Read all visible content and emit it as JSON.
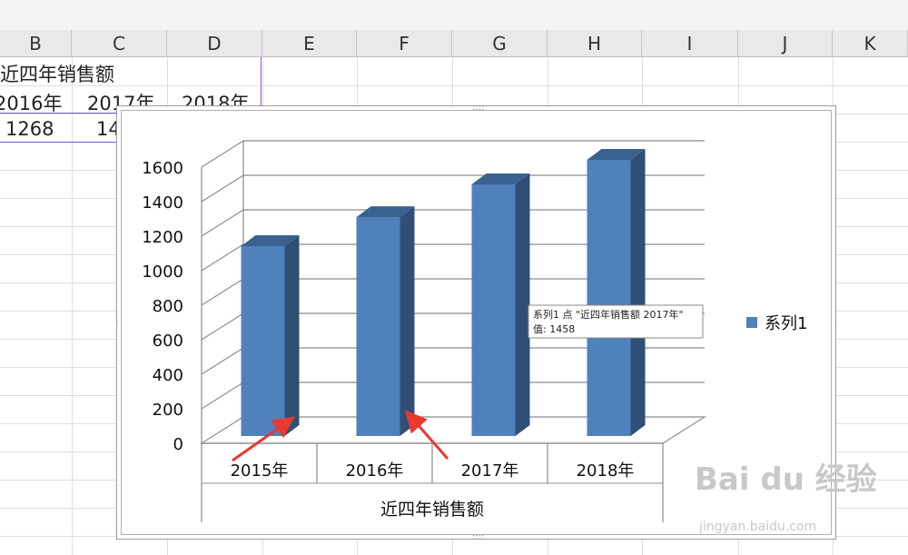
{
  "sheet": {
    "columns": [
      "B",
      "C",
      "D",
      "E",
      "F",
      "G",
      "H",
      "I",
      "J",
      "K"
    ],
    "title_cell": "近四年销售额",
    "year_cells": [
      "2016年",
      "2017年",
      "2018年"
    ],
    "value_cells": [
      "1268",
      "14"
    ]
  },
  "colors": {
    "bar_front": "#4f81bd",
    "bar_side": "#2f4f75",
    "bar_top": "#3a6190",
    "grid": "#8c8c8c",
    "arrow": "#e8392e"
  },
  "chart_data": {
    "type": "bar",
    "categories": [
      "2015年",
      "2016年",
      "2017年",
      "2018年"
    ],
    "group_label": "近四年销售额",
    "series": [
      {
        "name": "系列1",
        "values": [
          1100,
          1268,
          1458,
          1600
        ]
      }
    ],
    "ylim": [
      0,
      1600
    ],
    "yticks": [
      "0",
      "200",
      "400",
      "600",
      "800",
      "1000",
      "1200",
      "1400",
      "1600"
    ],
    "grid": true,
    "legend": "right",
    "tooltip": {
      "line1": "系列1 点 \"近四年销售额 2017年\"",
      "line2": "值: 1458"
    }
  },
  "watermark": {
    "text": "Bai du 经验",
    "sub": "jingyan.baidu.com"
  }
}
